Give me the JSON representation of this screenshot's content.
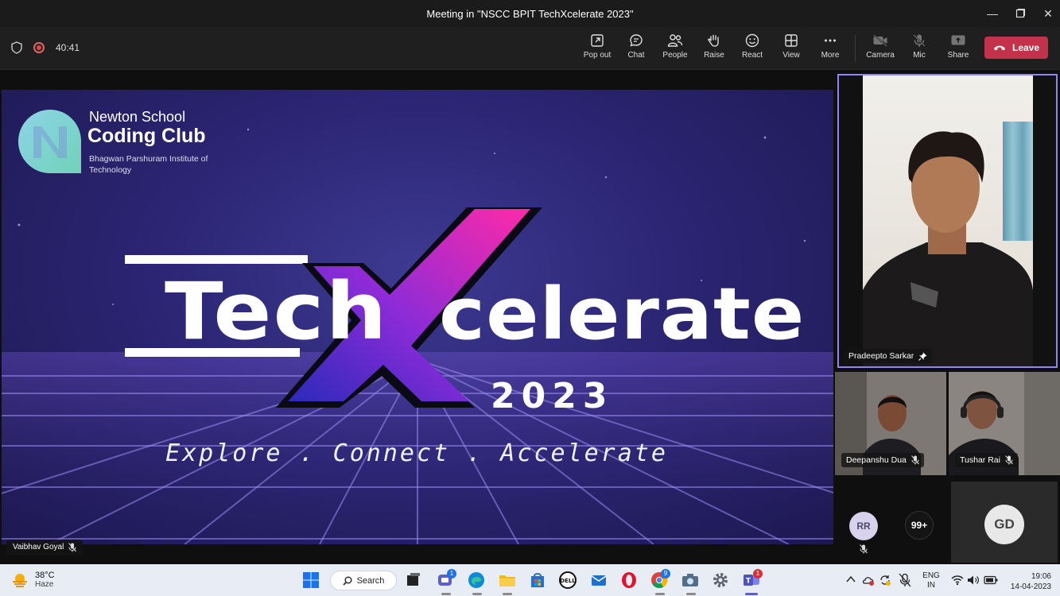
{
  "window": {
    "title": "Meeting in \"NSCC BPIT TechXcelerate 2023\"",
    "controls": [
      "minimize-icon",
      "maximize-icon",
      "close-icon"
    ]
  },
  "toolbar": {
    "timer": "40:41",
    "items": [
      {
        "label": "Pop out",
        "icon": "popout-icon"
      },
      {
        "label": "Chat",
        "icon": "chat-icon"
      },
      {
        "label": "People",
        "icon": "people-icon"
      },
      {
        "label": "Raise",
        "icon": "hand-icon"
      },
      {
        "label": "React",
        "icon": "smiley-icon"
      },
      {
        "label": "View",
        "icon": "grid-icon"
      },
      {
        "label": "More",
        "icon": "more-icon"
      },
      {
        "label": "Camera",
        "icon": "camera-off-icon"
      },
      {
        "label": "Mic",
        "icon": "mic-off-icon"
      },
      {
        "label": "Share",
        "icon": "share-icon"
      }
    ],
    "leave_label": "Leave",
    "leave_color": "#c4314b"
  },
  "slide": {
    "org_line1": "Newton School",
    "org_line2": "Coding Club",
    "org_line3": "Bhagwan Parshuram Institute of Technology",
    "event_part1": "Tech",
    "event_part2": "X",
    "event_part3": "celerate",
    "year": "2023",
    "tagline": "Explore . Connect . Accelerate",
    "presenter": "Vaibhav Goyal"
  },
  "participants": {
    "main": {
      "name": "Pradeepto Sarkar",
      "pinned": true
    },
    "tiles": [
      {
        "name": "Deepanshu Dua",
        "muted": true
      },
      {
        "name": "Tushar Rai",
        "muted": true
      }
    ],
    "avatar_rr": "RR",
    "overflow": "99+",
    "avatar_gd": "GD"
  },
  "taskbar": {
    "temperature": "38°C",
    "weather": "Haze",
    "search_label": "Search",
    "lang1": "ENG",
    "lang2": "IN",
    "time": "19:06",
    "date": "14-04-2023",
    "badges": {
      "chat": "1",
      "chrome": "9",
      "teams": "1"
    }
  }
}
